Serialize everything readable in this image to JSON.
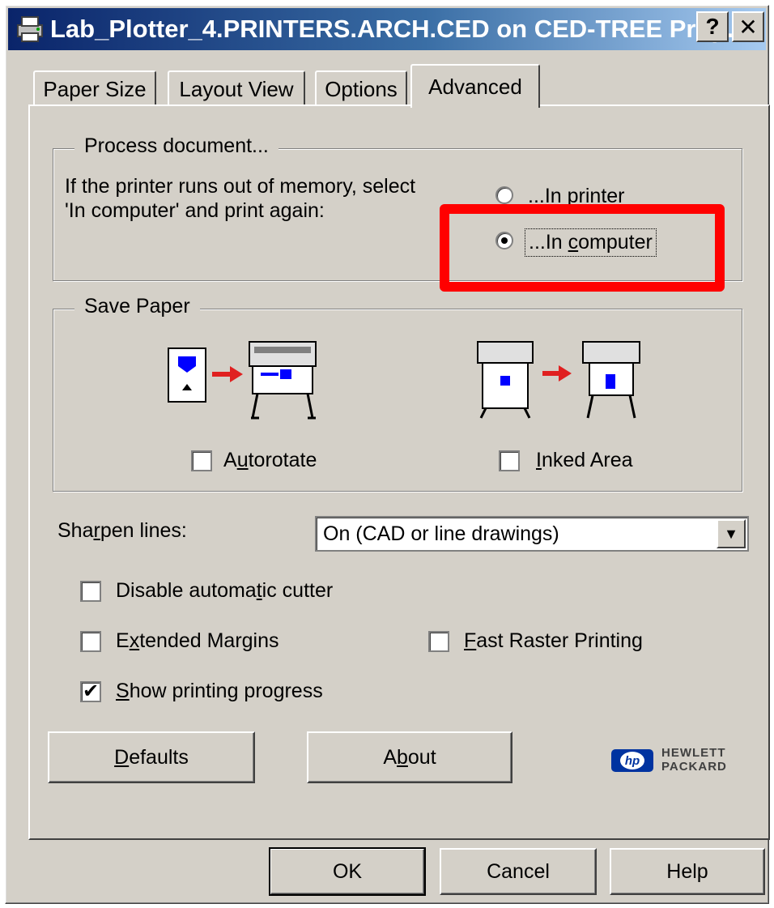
{
  "window": {
    "title": "Lab_Plotter_4.PRINTERS.ARCH.CED on CED-TREE Prop...",
    "help_button": "?",
    "close_button": "✕"
  },
  "tabs": [
    {
      "label": "Paper Size",
      "active": false
    },
    {
      "label": "Layout View",
      "active": false
    },
    {
      "label": "Options",
      "active": false
    },
    {
      "label": "Advanced",
      "active": true
    }
  ],
  "process_document": {
    "title": "Process document...",
    "description_line1": "If the printer runs out of memory, select",
    "description_line2": "'In computer' and print again:",
    "options": [
      {
        "label": "...In printer",
        "selected": false
      },
      {
        "label": "...In computer",
        "selected": true,
        "mnemonic": "c"
      }
    ]
  },
  "save_paper": {
    "title": "Save Paper",
    "autorotate": {
      "before": "A",
      "mnemonic": "u",
      "after": "torotate",
      "checked": false
    },
    "inked_area": {
      "before": "",
      "mnemonic": "I",
      "after": "nked Area",
      "checked": false
    }
  },
  "sharpen_lines": {
    "label_before": "Sha",
    "label_mnemonic": "r",
    "label_after": "pen lines:",
    "selected_value": "On (CAD or line drawings)"
  },
  "checkboxes": {
    "disable_cutter": {
      "before": "Disable automa",
      "mnemonic": "t",
      "after": "ic cutter",
      "checked": false
    },
    "extended_margins": {
      "before": "E",
      "mnemonic": "x",
      "after": "tended Margins",
      "checked": false
    },
    "fast_raster": {
      "before": "",
      "mnemonic": "F",
      "after": "ast Raster Printing",
      "checked": false
    },
    "show_progress": {
      "before": "",
      "mnemonic": "S",
      "after": "how printing progress",
      "checked": true
    }
  },
  "buttons": {
    "defaults": {
      "before": "",
      "mnemonic": "D",
      "after": "efaults"
    },
    "about": {
      "before": "A",
      "mnemonic": "b",
      "after": "out"
    },
    "ok": "OK",
    "cancel": "Cancel",
    "help": "Help"
  },
  "logo": {
    "mark": "hp",
    "line1": "HEWLETT",
    "line2": "PACKARD"
  },
  "colors": {
    "highlight": "#ff0000",
    "hp_blue": "#0033a0",
    "arrow_red": "#e02020"
  }
}
